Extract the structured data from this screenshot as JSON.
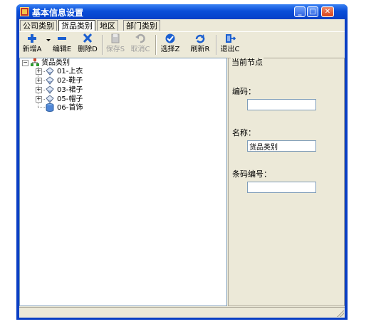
{
  "window": {
    "title": "基本信息设置",
    "controls": {
      "minimize": "_",
      "maximize": "□",
      "close": "✕"
    }
  },
  "tabs": [
    {
      "label": "公司类别",
      "active": false
    },
    {
      "label": "货品类别",
      "active": true
    },
    {
      "label": "地区",
      "active": false
    },
    {
      "label": "部门类别",
      "active": false
    }
  ],
  "toolbar": {
    "new": {
      "label": "新增A",
      "icon": "plus-icon",
      "enabled": true
    },
    "edit": {
      "label": "编辑E",
      "icon": "minus-icon",
      "enabled": true
    },
    "delete": {
      "label": "删除D",
      "icon": "x-icon",
      "enabled": true
    },
    "save": {
      "label": "保存S",
      "icon": "save-icon",
      "enabled": false
    },
    "cancel": {
      "label": "取消C",
      "icon": "undo-icon",
      "enabled": false
    },
    "select": {
      "label": "选择Z",
      "icon": "check-icon",
      "enabled": true
    },
    "refresh": {
      "label": "刷新R",
      "icon": "refresh-icon",
      "enabled": true
    },
    "exit": {
      "label": "退出C",
      "icon": "exit-door-icon",
      "enabled": true
    }
  },
  "tree": {
    "root": {
      "label": "货品类别",
      "expander": "−",
      "icon": "org-tree-icon"
    },
    "children": [
      {
        "label": "01-上衣",
        "expander": "+",
        "icon": "category-icon"
      },
      {
        "label": "02-鞋子",
        "expander": "+",
        "icon": "category-icon"
      },
      {
        "label": "03-裙子",
        "expander": "+",
        "icon": "category-icon"
      },
      {
        "label": "05-帽子",
        "expander": "+",
        "icon": "category-icon"
      },
      {
        "label": "06-首饰",
        "expander": "",
        "icon": "database-icon"
      }
    ]
  },
  "detail": {
    "group_title": "当前节点",
    "code": {
      "label": "编码：",
      "value": ""
    },
    "name": {
      "label": "名称：",
      "value": "货品类别"
    },
    "barcode": {
      "label": "条码编号：",
      "value": ""
    }
  },
  "colors": {
    "title_bar": "#0a4ed8",
    "face": "#ece9d8",
    "accent_blue": "#1b5fd0",
    "close_red": "#d7421b"
  }
}
